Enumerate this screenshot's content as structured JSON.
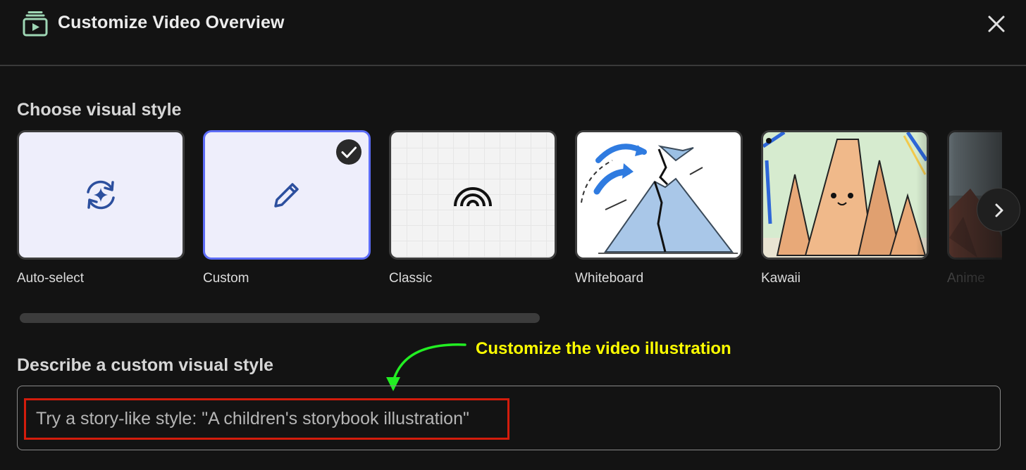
{
  "header": {
    "title": "Customize Video Overview",
    "icon": "video-library-icon",
    "close_icon": "close-icon"
  },
  "style_section": {
    "title": "Choose visual style",
    "selected": "Custom",
    "styles": [
      {
        "label": "Auto-select",
        "icon": "auto-select-sparkle-icon"
      },
      {
        "label": "Custom",
        "icon": "pencil-icon",
        "selected": true
      },
      {
        "label": "Classic",
        "icon": "rainbow-arcs-icon"
      },
      {
        "label": "Whiteboard",
        "thumbnail": "volcano sketch illustration"
      },
      {
        "label": "Kawaii",
        "thumbnail": "cute mountains illustration"
      },
      {
        "label": "Anime",
        "thumbnail": "anime landscape illustration"
      }
    ],
    "next_icon": "chevron-right-icon"
  },
  "custom_section": {
    "title": "Describe a custom visual style",
    "placeholder": "Try a story-like style: \"A children's storybook illustration\""
  },
  "annotation": {
    "text": "Customize the video illustration",
    "color": "#ffff00",
    "arrow_color": "#22ee22",
    "box_color": "#d31c0c"
  },
  "colors": {
    "background": "#131313",
    "selected_border": "#5c6cf6",
    "card_bg": "#eeeefb"
  }
}
